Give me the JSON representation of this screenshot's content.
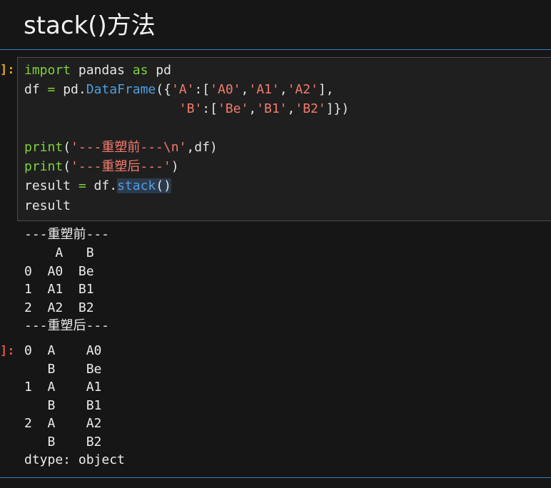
{
  "heading": "stack()方法",
  "prompts": {
    "in": "]:",
    "out": "]:"
  },
  "code": {
    "l1": {
      "a": "import",
      "b": " pandas ",
      "c": "as",
      "d": " pd"
    },
    "l2": {
      "a": "df ",
      "b": "=",
      "c": " pd.",
      "d": "DataFrame",
      "e": "({",
      "f": "'A'",
      "g": ":[",
      "h": "'A0'",
      "i": ",",
      "j": "'A1'",
      "k": ",",
      "l": "'A2'",
      "m": "],"
    },
    "l3": {
      "a": "                    ",
      "b": "'B'",
      "c": ":[",
      "d": "'Be'",
      "e": ",",
      "f": "'B1'",
      "g": ",",
      "h": "'B2'",
      "i": "]})"
    },
    "l5": {
      "a": "print",
      "b": "(",
      "c": "'---重塑前---",
      "d": "\\n",
      "e": "'",
      "f": ",df)"
    },
    "l6": {
      "a": "print",
      "b": "(",
      "c": "'---重塑后---'",
      "d": ")"
    },
    "l7": {
      "a": "result ",
      "b": "=",
      "c": " df.",
      "d": "stack",
      "e": "()"
    },
    "l8": {
      "a": "result"
    }
  },
  "stdout": [
    "---重塑前---",
    "    A   B",
    "0  A0  Be",
    "1  A1  B1",
    "2  A2  B2",
    "---重塑后---"
  ],
  "result": [
    "0  A    A0",
    "   B    Be",
    "1  A    A1",
    "   B    B1",
    "2  A    A2",
    "   B    B2",
    "dtype: object"
  ]
}
